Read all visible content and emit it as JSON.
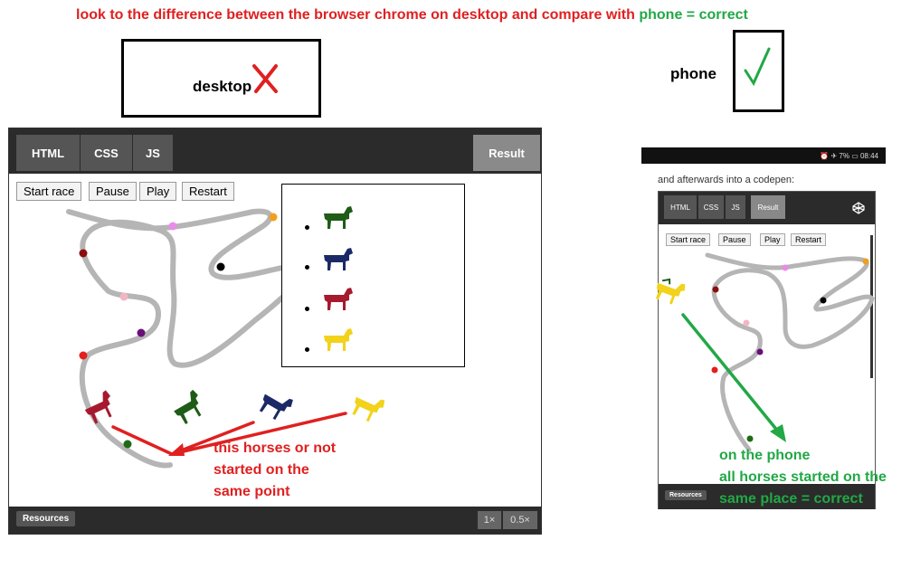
{
  "heading": {
    "main": "look to the difference between the browser chrome on desktop and compare with",
    "ok": "phone = correct"
  },
  "labels": {
    "desktop": "desktop",
    "phone": "phone",
    "cross": "✗",
    "check": "✓"
  },
  "desktop_pen": {
    "tabs": [
      "HTML",
      "CSS",
      "JS"
    ],
    "result": "Result",
    "buttons": [
      "Start race",
      "Pause",
      "Play",
      "Restart"
    ],
    "resources": "Resources",
    "zoom": [
      "1×",
      "0.5×"
    ]
  },
  "annotation_desktop": {
    "line1": "this horses or not",
    "line2": "started on the",
    "line3": "same point"
  },
  "phone_screen": {
    "status": "⏰ ✈ 7% ▭ 08:44",
    "intro": "and afterwards into a codepen:",
    "tabs": [
      "HTML",
      "CSS",
      "JS"
    ],
    "result": "Result",
    "buttons": [
      "Start race",
      "Pause",
      "Play",
      "Restart"
    ],
    "resources": "Resources"
  },
  "annotation_phone": {
    "line1": "on the phone",
    "line2": "all horses started on the",
    "line3": "same place = correct"
  },
  "colors": {
    "red": "#e02020",
    "green": "#22a846",
    "track": "#b5b5b5",
    "horse_green": "#1e5c17",
    "horse_navy": "#1b2a66",
    "horse_red": "#a6192e",
    "horse_yellow": "#f2d21b"
  }
}
